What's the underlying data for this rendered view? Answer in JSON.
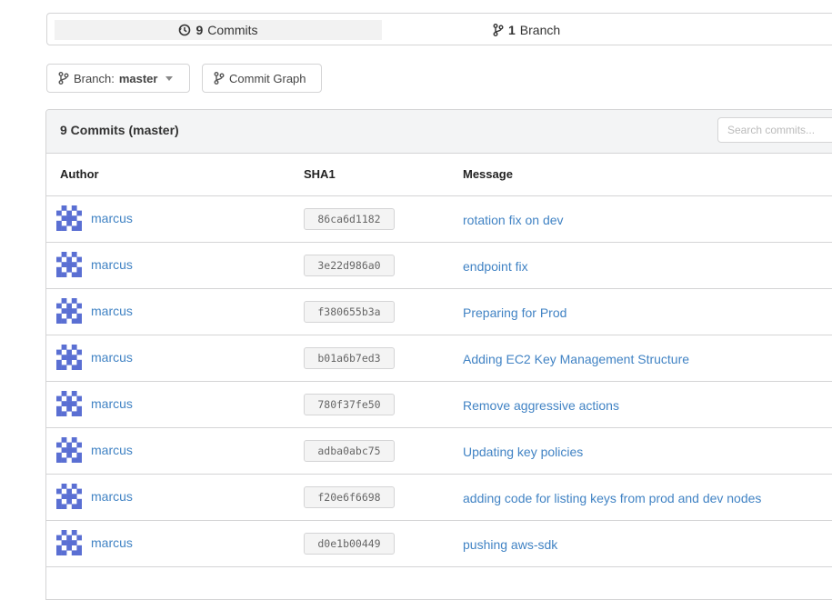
{
  "stats": {
    "commits_count": "9",
    "commits_label": "Commits",
    "commits_icon": "history-icon",
    "branches_count": "1",
    "branches_label": "Branch",
    "branches_icon": "branch-icon"
  },
  "toolbar": {
    "branch_prefix": "Branch:",
    "branch_name": "master",
    "commit_graph_label": "Commit Graph"
  },
  "commits_panel": {
    "title": "9 Commits (master)",
    "search_placeholder": "Search commits...",
    "columns": {
      "author": "Author",
      "sha": "SHA1",
      "message": "Message"
    },
    "rows": [
      {
        "author": "marcus",
        "sha": "86ca6d1182",
        "message": "rotation fix on dev"
      },
      {
        "author": "marcus",
        "sha": "3e22d986a0",
        "message": "endpoint fix"
      },
      {
        "author": "marcus",
        "sha": "f380655b3a",
        "message": "Preparing for Prod"
      },
      {
        "author": "marcus",
        "sha": "b01a6b7ed3",
        "message": "Adding EC2 Key Management Structure"
      },
      {
        "author": "marcus",
        "sha": "780f37fe50",
        "message": "Remove aggressive actions"
      },
      {
        "author": "marcus",
        "sha": "adba0abc75",
        "message": "Updating key policies"
      },
      {
        "author": "marcus",
        "sha": "f20e6f6698",
        "message": "adding code for listing keys from prod and dev nodes"
      },
      {
        "author": "marcus",
        "sha": "d0e1b00449",
        "message": "pushing aws-sdk"
      }
    ]
  },
  "colors": {
    "link": "#4183c4",
    "avatar": "#5a6fd3",
    "border": "#d4d4d5"
  }
}
